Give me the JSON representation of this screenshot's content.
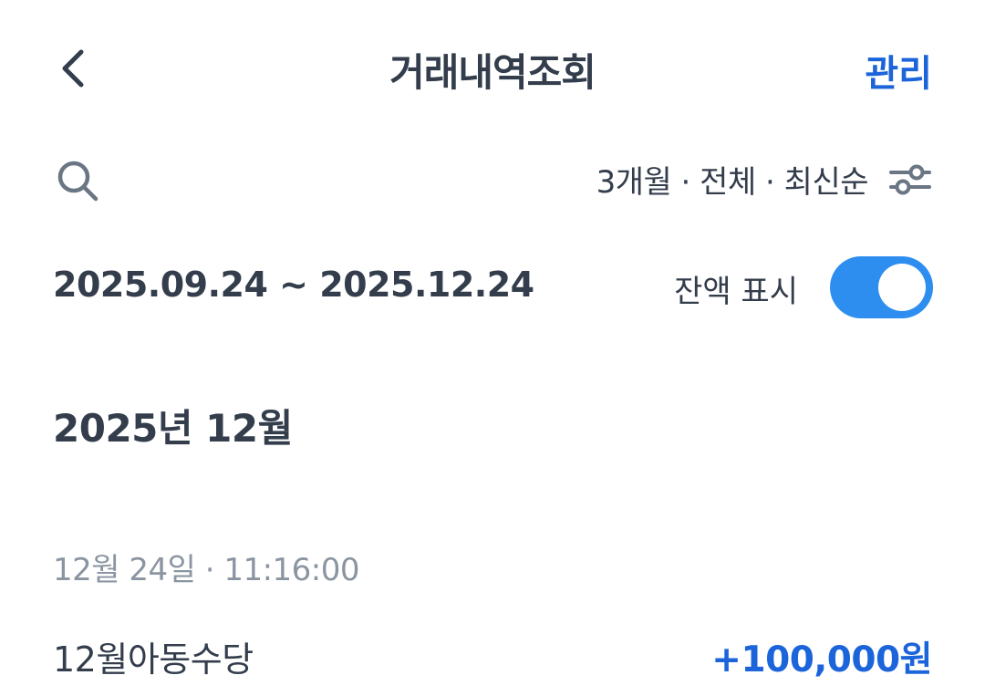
{
  "header": {
    "title": "거래내역조회",
    "manage_label": "관리",
    "back_icon": "chevron-left-icon"
  },
  "toolbar": {
    "search_icon": "search-icon",
    "filter_summary": "3개월 · 전체 · 최신순",
    "filter_icon": "sliders-icon"
  },
  "range": {
    "date_range": "2025.09.24 ~ 2025.12.24",
    "balance_label": "잔액 표시",
    "balance_toggle_on": true
  },
  "month": {
    "heading": "2025년 12월"
  },
  "transactions": [
    {
      "datetime": "12월 24일 · 11:16:00",
      "name": "12월아동수당",
      "amount": "+100,000원"
    }
  ],
  "colors": {
    "accent": "#1b64da",
    "toggle": "#2e8ef0",
    "text_primary": "#333d4b",
    "text_secondary": "#8b95a1",
    "icon": "#6b7684"
  }
}
